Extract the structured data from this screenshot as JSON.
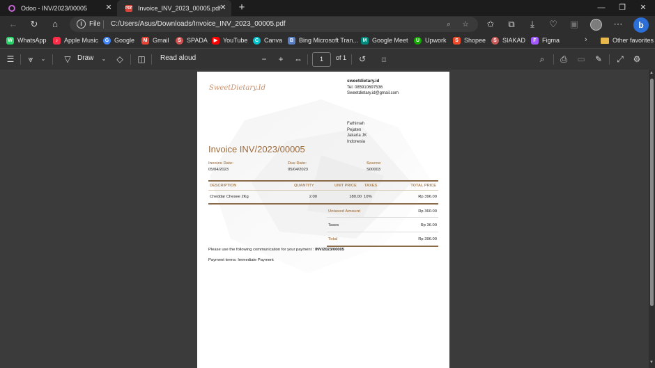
{
  "tabs": [
    {
      "title": "Odoo - INV/2023/00005",
      "icon": "odoo-icon"
    },
    {
      "title": "Invoice_INV_2023_00005.pdf",
      "icon": "pdf-icon"
    }
  ],
  "address": {
    "scheme_label": "File",
    "url": "C:/Users/Asus/Downloads/Invoice_INV_2023_00005.pdf"
  },
  "favorites": [
    {
      "label": "WhatsApp",
      "color": "#25d366",
      "glyph": "W"
    },
    {
      "label": "Apple Music",
      "color": "#fa2d48",
      "glyph": "♪"
    },
    {
      "label": "Google",
      "color": "#4285f4",
      "glyph": "G"
    },
    {
      "label": "Gmail",
      "color": "#ea4335",
      "glyph": "M"
    },
    {
      "label": "SPADA",
      "color": "#d05050",
      "glyph": "S"
    },
    {
      "label": "YouTube",
      "color": "#ff0000",
      "glyph": "▶"
    },
    {
      "label": "Canva",
      "color": "#00c4cc",
      "glyph": "C"
    },
    {
      "label": "Bing Microsoft Tran...",
      "color": "#5a7fc7",
      "glyph": "B"
    },
    {
      "label": "Google Meet",
      "color": "#00897b",
      "glyph": "M"
    },
    {
      "label": "Upwork",
      "color": "#14a800",
      "glyph": "U"
    },
    {
      "label": "Shopee",
      "color": "#ee4d2d",
      "glyph": "S"
    },
    {
      "label": "SIAKAD",
      "color": "#c85a5a",
      "glyph": "S"
    },
    {
      "label": "Figma",
      "color": "#a259ff",
      "glyph": "F"
    }
  ],
  "other_favorites": "Other favorites",
  "pdf_toolbar": {
    "draw_label": "Draw",
    "read_aloud_label": "Read aloud",
    "page_current": "1",
    "page_total": "of 1"
  },
  "invoice": {
    "logo_text": "SweetDietary.Id",
    "company": {
      "name": "sweetdietary.id",
      "tel": "Tel: 085910697536",
      "email": "Sweetdietary.id@gmail.com"
    },
    "customer": {
      "name": "Fathimah",
      "line1": "Pejaten",
      "line2": "Jakarta JK",
      "country": "Indonesia"
    },
    "title": "Invoice INV/2023/00005",
    "invoice_date_label": "Invoice Date:",
    "invoice_date": "05/04/2023",
    "due_date_label": "Due Date:",
    "due_date": "05/04/2023",
    "source_label": "Source:",
    "source": "S00003",
    "columns": {
      "description": "DESCRIPTION",
      "quantity": "QUANTITY",
      "unit_price": "UNIT PRICE",
      "taxes": "TAXES",
      "total_price": "TOTAL PRICE"
    },
    "lines": [
      {
        "description": "Cheddar Chesee 2Kg",
        "quantity": "2.00",
        "unit_price": "180.00",
        "taxes": "10%",
        "total_price": "Rp 396.00"
      }
    ],
    "totals": {
      "untaxed_label": "Untaxed Amount",
      "untaxed_value": "Rp 360.00",
      "taxes_label": "Taxes",
      "taxes_value": "Rp 36.00",
      "total_label": "Total",
      "total_value": "Rp 396.00"
    },
    "communication_text": "Please use the following communication for your payment :",
    "communication_ref": "INV/2023/00005",
    "payment_terms": "Payment terms: Immediate Payment"
  },
  "colors": {
    "accent": "#b0865a",
    "title": "#9a6a3c",
    "rule": "#8a6a48"
  }
}
